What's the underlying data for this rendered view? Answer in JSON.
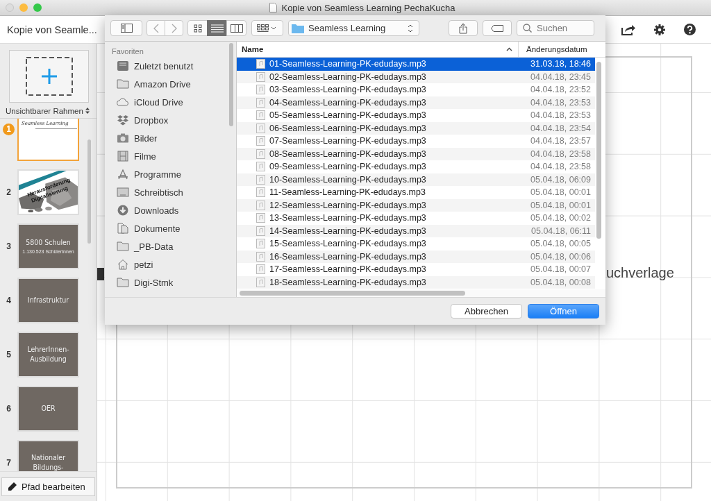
{
  "window": {
    "title": "Kopie von Seamless Learning PechaKucha"
  },
  "toolbar": {
    "title": "Kopie von Seamle..."
  },
  "sidebar": {
    "frame_type": "Unsichtbarer Rahmen",
    "slides": [
      {
        "number": "1",
        "selected": true,
        "kind": "title",
        "lines": [
          "Seamless Learning"
        ]
      },
      {
        "number": "2",
        "selected": false,
        "lines": [
          "Herausforderung",
          "Digitalisierung"
        ]
      },
      {
        "number": "3",
        "selected": false,
        "kind": "text",
        "lines": [
          "5800 Schulen"
        ],
        "subtitle": "1.130.523 SchülerInnen"
      },
      {
        "number": "4",
        "selected": false,
        "kind": "text",
        "lines": [
          "Infrastruktur"
        ]
      },
      {
        "number": "5",
        "selected": false,
        "kind": "text",
        "lines": [
          "LehrerInnen-",
          "Ausbildung"
        ]
      },
      {
        "number": "6",
        "selected": false,
        "kind": "text",
        "lines": [
          "OER"
        ]
      },
      {
        "number": "7",
        "selected": false,
        "kind": "text",
        "lines": [
          "Nationaler",
          "Bildungs-"
        ]
      }
    ],
    "edit_path_button": "Pfad bearbeiten"
  },
  "canvas": {
    "text": "uchverlage"
  },
  "dialog": {
    "path": "Seamless Learning",
    "search": {
      "placeholder": "Suchen"
    },
    "view_modes": [
      {
        "kind": "icons",
        "selected": false
      },
      {
        "kind": "list",
        "selected": true
      },
      {
        "kind": "columns",
        "selected": false
      }
    ],
    "favorites_header": "Favoriten",
    "favorites": [
      {
        "label": "Zuletzt benutzt",
        "kind": "recents"
      },
      {
        "label": "Amazon Drive",
        "kind": "folder"
      },
      {
        "label": "iCloud Drive",
        "kind": "cloud"
      },
      {
        "label": "Dropbox",
        "kind": "dropbox"
      },
      {
        "label": "Bilder",
        "kind": "camera"
      },
      {
        "label": "Filme",
        "kind": "film"
      },
      {
        "label": "Programme",
        "kind": "apps"
      },
      {
        "label": "Schreibtisch",
        "kind": "desktop"
      },
      {
        "label": "Downloads",
        "kind": "download"
      },
      {
        "label": "Dokumente",
        "kind": "document"
      },
      {
        "label": "_PB-Data",
        "kind": "folder"
      },
      {
        "label": "petzi",
        "kind": "home"
      },
      {
        "label": "Digi-Stmk",
        "kind": "folder"
      }
    ],
    "columns": [
      {
        "label": "Name",
        "sorted": true
      },
      {
        "label": "Änderungsdatum",
        "sorted": false
      }
    ],
    "files": [
      {
        "name": "01-Seamless-Learning-PK-edudays.mp3",
        "date": "31.03.18, 18:46",
        "selected": true
      },
      {
        "name": "02-Seamless-Learning-PK-edudays.mp3",
        "date": "04.04.18, 23:45",
        "selected": false
      },
      {
        "name": "03-Seamless-Learning-PK-edudays.mp3",
        "date": "04.04.18, 23:52",
        "selected": false
      },
      {
        "name": "04-Seamless-Learning-PK-edudays.mp3",
        "date": "04.04.18, 23:53",
        "selected": false
      },
      {
        "name": "05-Seamless-Learning-PK-edudays.mp3",
        "date": "04.04.18, 23:53",
        "selected": false
      },
      {
        "name": "06-Seamless-Learning-PK-edudays.mp3",
        "date": "04.04.18, 23:54",
        "selected": false
      },
      {
        "name": "07-Seamless-Learning-PK-edudays.mp3",
        "date": "04.04.18, 23:57",
        "selected": false
      },
      {
        "name": "08-Seamless-Learning-PK-edudays.mp3",
        "date": "04.04.18, 23:58",
        "selected": false
      },
      {
        "name": "09-Seamless-Learning-PK-edudays.mp3",
        "date": "04.04.18, 23:58",
        "selected": false
      },
      {
        "name": "10-Seamless-Learning-PK-edudays.mp3",
        "date": "05.04.18, 06:09",
        "selected": false
      },
      {
        "name": "11-Seamless-Learning-PK-edudays.mp3",
        "date": "05.04.18, 00:01",
        "selected": false
      },
      {
        "name": "12-Seamless-Learning-PK-edudays.mp3",
        "date": "05.04.18, 00:01",
        "selected": false
      },
      {
        "name": "13-Seamless-Learning-PK-edudays.mp3",
        "date": "05.04.18, 00:02",
        "selected": false
      },
      {
        "name": "14-Seamless-Learning-PK-edudays.mp3",
        "date": "05.04.18, 06:11",
        "selected": false
      },
      {
        "name": "15-Seamless-Learning-PK-edudays.mp3",
        "date": "05.04.18, 00:05",
        "selected": false
      },
      {
        "name": "16-Seamless-Learning-PK-edudays.mp3",
        "date": "05.04.18, 00:06",
        "selected": false
      },
      {
        "name": "17-Seamless-Learning-PK-edudays.mp3",
        "date": "05.04.18, 00:07",
        "selected": false
      },
      {
        "name": "18-Seamless-Learning-PK-edudays.mp3",
        "date": "05.04.18, 00:08",
        "selected": false
      }
    ],
    "buttons": {
      "cancel": "Abbrechen",
      "open": "Öffnen"
    }
  }
}
